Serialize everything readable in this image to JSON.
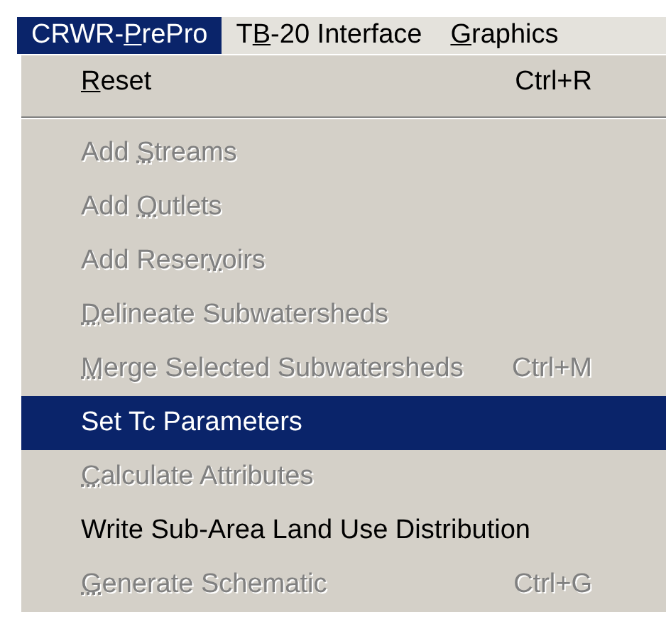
{
  "menu_bar": [
    {
      "label": {
        "pre": "CRWR-",
        "key": "P",
        "post": "rePro"
      },
      "selected": true
    },
    {
      "label": {
        "pre": "T",
        "key": "B",
        "post": "-20 Interface"
      },
      "selected": false
    },
    {
      "label": {
        "key": "G",
        "post": "raphics"
      },
      "selected": false
    }
  ],
  "menu": [
    {
      "kind": "item",
      "label": {
        "key": "R",
        "post": "eset"
      },
      "shortcut": "Ctrl+R",
      "disabled": false,
      "selected": false
    },
    {
      "kind": "separator"
    },
    {
      "kind": "item",
      "label": {
        "pre": "Add ",
        "key": "S",
        "post": "treams"
      },
      "disabled": true,
      "selected": false
    },
    {
      "kind": "item",
      "label": {
        "pre": "Add ",
        "key": "O",
        "post": "utlets"
      },
      "disabled": true,
      "selected": false
    },
    {
      "kind": "item",
      "label": {
        "pre": "Add Reser",
        "key": "v",
        "post": "oirs"
      },
      "disabled": true,
      "selected": false
    },
    {
      "kind": "item",
      "label": {
        "key": "D",
        "post": "elineate Subwatersheds"
      },
      "disabled": true,
      "selected": false
    },
    {
      "kind": "item",
      "label": {
        "key": "M",
        "post": "erge Selected Subwatersheds"
      },
      "shortcut": "Ctrl+M",
      "disabled": true,
      "selected": false
    },
    {
      "kind": "item",
      "label": {
        "pre": "Set Tc Parameters"
      },
      "disabled": false,
      "selected": true
    },
    {
      "kind": "item",
      "label": {
        "key": "C",
        "post": "alculate Attributes"
      },
      "disabled": true,
      "selected": false
    },
    {
      "kind": "item",
      "label": {
        "pre": "Write Sub-Area Land Use Distribution"
      },
      "disabled": false,
      "selected": false
    },
    {
      "kind": "item",
      "label": {
        "key": "G",
        "post": "enerate Schematic"
      },
      "shortcut": "Ctrl+G",
      "disabled": true,
      "selected": false
    }
  ]
}
